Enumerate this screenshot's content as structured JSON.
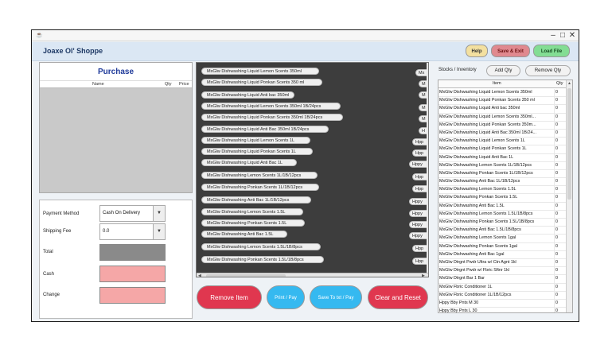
{
  "window": {
    "app_icon": "☕",
    "controls": [
      "‒",
      "□",
      "✕"
    ]
  },
  "header": {
    "shop_name": "Joaxe Ol' Shoppe",
    "help_label": "Help",
    "save_exit_label": "Save & Exit",
    "load_file_label": "Load File"
  },
  "purchase": {
    "title": "Purchase",
    "columns": {
      "name": "Name",
      "qty": "Qty",
      "price": "Price"
    }
  },
  "payment": {
    "method_label": "Payment Method",
    "method_value": "Cash On Delivery",
    "shipping_label": "Shipping Fee",
    "shipping_value": "0.0",
    "total_label": "Total",
    "cash_label": "Cash",
    "change_label": "Change",
    "colors": {
      "total": "#8a8a8a",
      "cash": "#f5a7a7",
      "change": "#f5a7a7"
    }
  },
  "items": {
    "left": [
      "MxGlw Dishwashing Liquid Lemon Scents 350ml",
      "MxGlw Dishwashing Liquid Ponkan Scents 350 ml",
      "MxGlw Dishwashing Liquid Anti bac 350ml",
      "MxGlw Dishwashing Liquid Lemon Scents 350ml 1B/24pcs",
      "MxGlw Dishwashing Liquid Ponkan Scents 350ml 1B/24pcs",
      "MxGlw Dishwashing Liquid Anti Bac 350ml 1B/24pcs",
      "MxGlw Dishwashing Liquid Lemon Scents 1L",
      "MxGlw Dishwashing Liquid Ponkan Scents 1L",
      "MxGlw Dishwashing Liquid Anti Bac 1L",
      "MxGlw Dishwashing Lemon Scents 1L/1B/12pcs",
      "MxGlw Dishwashing Ponkan Scents 1L/1B/12pcs",
      "MxGlw Dishwashing Anti Bac 1L/1B/12pcs",
      "MxGlw Dishwashing Lemon Scents 1.5L",
      "MxGlw Dishwashing Ponkan Scents 1.5L",
      "MxGlw Dishwashing Anti Bac 1.5L",
      "MxGlw Dishwashing Lemon Scents 1.5L/1B/8pcs",
      "MxGlw Dishwashing Ponkan Scents 1.5L/1B/8pcs"
    ],
    "right": [
      "Mx",
      "M",
      "M",
      "M",
      "M",
      "H",
      "Hpp",
      "Hpp",
      "Hppy",
      "Hpp",
      "Hpp",
      "Hppy",
      "Hppy",
      "Hppy",
      "Hppy",
      "Hpp",
      "Hpp"
    ]
  },
  "actions": {
    "remove_item": "Remove Item",
    "print_pay": "Print / Pay",
    "save_txt_pay": "Save To txt / Pay",
    "clear_reset": "Clear and Reset"
  },
  "stocks": {
    "label": "Stocks / Inventory",
    "add_qty": "Add Qty",
    "remove_qty": "Remove Qty",
    "col_item": "Item",
    "col_qty": "Qty",
    "rows": [
      {
        "name": "MxGlw Dishwashing Liquid Lemon Scents 350ml",
        "qty": "0"
      },
      {
        "name": "MxGlw Dishwashing Liquid Ponkan Scents 350 ml",
        "qty": "0"
      },
      {
        "name": "MxGlw Dishwashing Liquid Anti bac 350ml",
        "qty": "0"
      },
      {
        "name": "MxGlw Dishwashing Liquid Lemon Scents 350ml...",
        "qty": "0"
      },
      {
        "name": "MxGlw Dishwashing Liquid Ponkan Scents 350m...",
        "qty": "0"
      },
      {
        "name": "MxGlw Dishwashing Liquid Anti Bac 350ml 1B/24...",
        "qty": "0"
      },
      {
        "name": "MxGlw Dishwashing Liquid Lemon Scents 1L",
        "qty": "0"
      },
      {
        "name": "MxGlw Dishwashing Liquid Ponkan Scents 1L",
        "qty": "0"
      },
      {
        "name": "MxGlw Dishwashing Liquid Anti Bac 1L",
        "qty": "0"
      },
      {
        "name": "MxGlw Dishwashing Lemon Scents 1L/1B/12pcs",
        "qty": "0"
      },
      {
        "name": "MxGlw Dishwashing Ponkan Scents 1L/1B/12pcs",
        "qty": "0"
      },
      {
        "name": "MxGlw Dishwashing Anti Bac 1L/1B/12pcs",
        "qty": "0"
      },
      {
        "name": "MxGlw Dishwashing Lemon Scents 1.5L",
        "qty": "0"
      },
      {
        "name": "MxGlw Dishwashing Ponkan Scents 1.5L",
        "qty": "0"
      },
      {
        "name": "MxGlw Dishwashing Anti Bac 1.5L",
        "qty": "0"
      },
      {
        "name": "MxGlw Dishwashing Lemon Scents 1.5L/1B/8pcs",
        "qty": "0"
      },
      {
        "name": "MxGlw Dishwashing Ponkan Scents 1.5L/1B/8pcs",
        "qty": "0"
      },
      {
        "name": "MxGlw Dishwashing Anti Bac 1.5L/1B/8pcs",
        "qty": "0"
      },
      {
        "name": "MxGlw Dishwashing Lemon Scents 1gal",
        "qty": "0"
      },
      {
        "name": "MxGlw Dishwashing Ponkan Scents 1gal",
        "qty": "0"
      },
      {
        "name": "MxGlw Dishwashing Anti Bac 1gal",
        "qty": "0"
      },
      {
        "name": "MxGlw Dtrgnt Pwdr Ultra w/ Ctn Agnt 1kl",
        "qty": "0"
      },
      {
        "name": "MxGlw Dtrgnt Pwdr w/ Fbric Sftnr 1kl",
        "qty": "0"
      },
      {
        "name": "MxGlw Dtrgnt Bar 1 Bar",
        "qty": "0"
      },
      {
        "name": "MxGlw Fbric Conditioner 1L",
        "qty": "0"
      },
      {
        "name": "MxGlw Fbric Conditioner 1L/1B/12pcs",
        "qty": "0"
      },
      {
        "name": "Hppy Bby Pnts M 30",
        "qty": "0"
      },
      {
        "name": "Hppy Bby Pnts L 30",
        "qty": "0"
      }
    ]
  }
}
